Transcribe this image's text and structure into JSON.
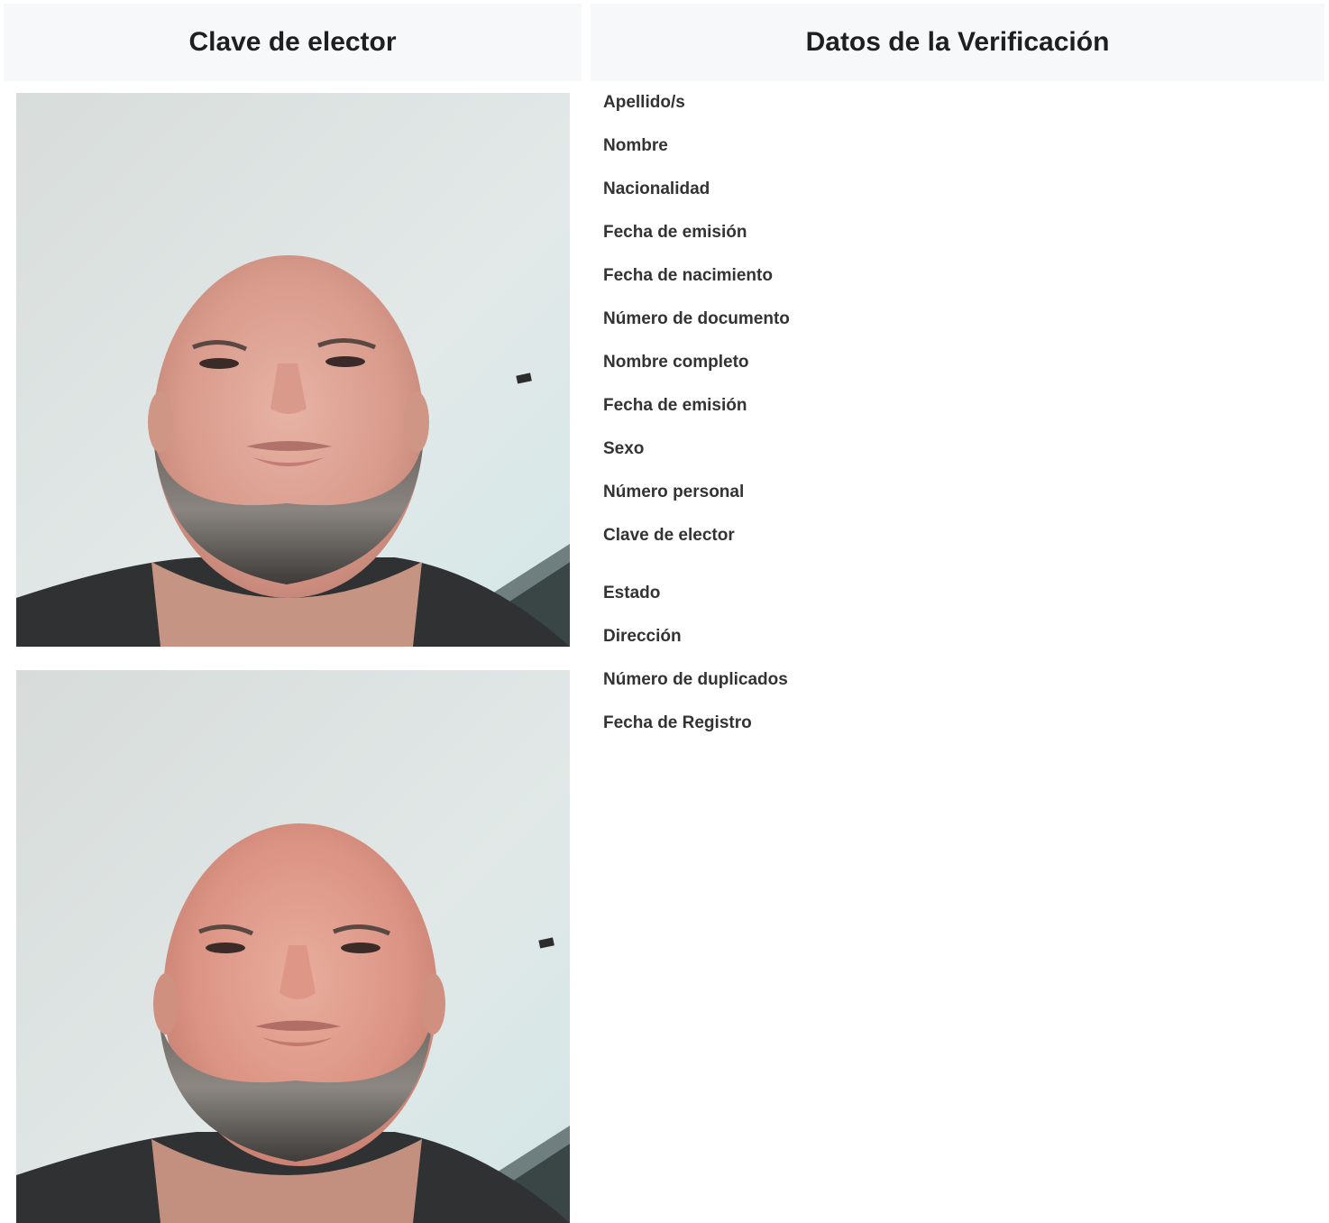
{
  "left_panel": {
    "title": "Clave de elector",
    "photos": [
      {
        "icon": "selfie-photo"
      },
      {
        "icon": "selfie-photo"
      }
    ]
  },
  "right_panel": {
    "title": "Datos de la Verificación",
    "fields": [
      "Apellido/s",
      "Nombre",
      "Nacionalidad",
      "Fecha de emisión",
      "Fecha de nacimiento",
      "Número de documento",
      "Nombre completo",
      "Fecha de emisión",
      "Sexo",
      "Número personal",
      "Clave de elector",
      "Estado",
      "Dirección",
      "Número de duplicados",
      "Fecha de Registro"
    ]
  },
  "colors": {
    "header_bg": "#f7f8f9",
    "label_text": "#333333"
  }
}
